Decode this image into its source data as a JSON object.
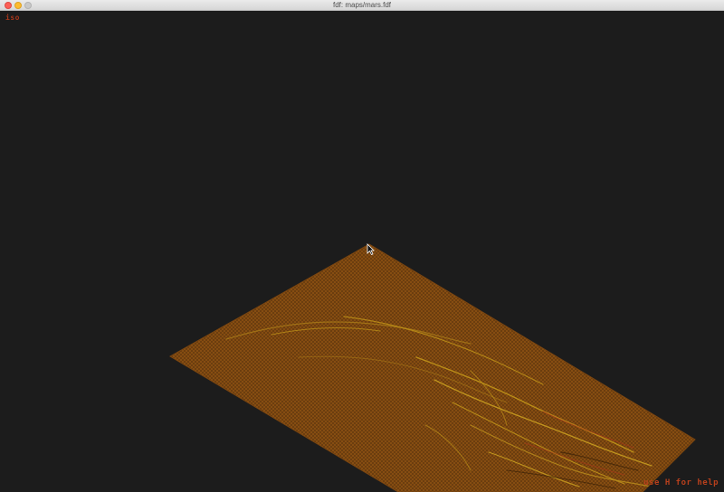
{
  "window": {
    "title": "fdf: maps/mars.fdf"
  },
  "hud": {
    "projection_label": "iso",
    "help_hint": "use H for help"
  },
  "map": {
    "colors": {
      "base": "#8a4f12",
      "wire": "#5a330b",
      "ridge_yellow": "#c59a1a",
      "ridge_red": "#a8361a",
      "background": "#1c1c1c"
    }
  },
  "cursor": {
    "icon": "arrow-cursor-icon"
  }
}
